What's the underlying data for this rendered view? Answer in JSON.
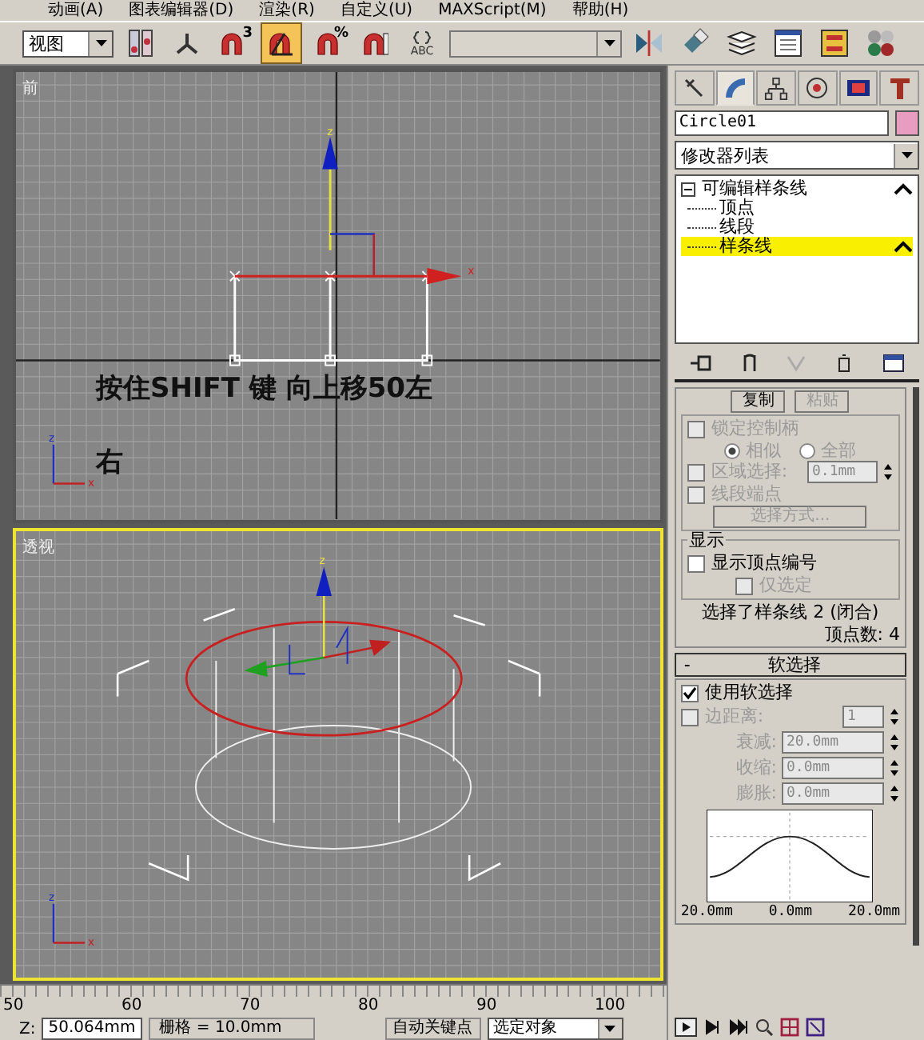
{
  "menu": [
    "动画(A)",
    "图表编辑器(D)",
    "渲染(R)",
    "自定义(U)",
    "MAXScript(M)",
    "帮助(H)"
  ],
  "toolbar": {
    "view_dropdown": "视图",
    "tools": [
      {
        "kind": "pivot",
        "selected": false
      },
      {
        "kind": "axis",
        "selected": false
      },
      {
        "kind": "snap",
        "label": "3",
        "selected": false
      },
      {
        "kind": "angle-snap",
        "selected": true
      },
      {
        "kind": "snap",
        "label": "%",
        "selected": false
      },
      {
        "kind": "spinner-snap",
        "selected": false
      },
      {
        "kind": "named-selection",
        "label": "ABC",
        "selected": false
      },
      {
        "kind": "selection-set",
        "selected": false
      },
      {
        "kind": "mirror",
        "selected": false
      },
      {
        "kind": "align",
        "selected": false
      },
      {
        "kind": "layers",
        "selected": false
      },
      {
        "kind": "curve-editor",
        "selected": false
      },
      {
        "kind": "schematic",
        "selected": false
      },
      {
        "kind": "material",
        "selected": false
      }
    ]
  },
  "viewports": [
    {
      "kind": "front",
      "label": "前",
      "active": false,
      "annotation": "按住SHIFT 键  向上移50左",
      "annotation_2": "右",
      "gizmo_z": "z",
      "gizmo_x": "x",
      "axis_z": "z",
      "axis_x": "x"
    },
    {
      "kind": "perspective",
      "label": "透视",
      "active": true,
      "gizmo_z": "z",
      "axis_z": "z",
      "axis_x": "x"
    }
  ],
  "command_panel": {
    "tabs": [
      {
        "kind": "create",
        "selected": false
      },
      {
        "kind": "modify",
        "selected": true
      },
      {
        "kind": "hierarchy",
        "selected": false
      },
      {
        "kind": "motion",
        "selected": false
      },
      {
        "kind": "display",
        "selected": false
      },
      {
        "kind": "utilities",
        "selected": false
      }
    ],
    "object": {
      "name": "Circle01",
      "color": "#e89cc0"
    },
    "modifier_list": "修改器列表",
    "stack": {
      "label": "可编辑样条线",
      "expanded": true,
      "children": [
        {
          "label": "顶点",
          "selected": false
        },
        {
          "label": "线段",
          "selected": false
        },
        {
          "label": "样条线",
          "selected": true
        }
      ]
    },
    "selection": {
      "copy": "复制",
      "paste": {
        "label": "粘贴",
        "disabled": true
      },
      "lock_handles": {
        "label": "锁定控制柄",
        "checked": false,
        "disabled": true
      },
      "radios": [
        {
          "label": "相似",
          "selected": true
        },
        {
          "label": "全部",
          "selected": false
        }
      ],
      "area_select": {
        "label": "区域选择:",
        "checked": false,
        "value": "0.1mm"
      },
      "segment_end": {
        "label": "线段端点",
        "checked": false
      },
      "select_by": "选择方式...",
      "display_title": "显示",
      "show_vertex_numbers": {
        "label": "显示顶点编号",
        "checked": false
      },
      "selected_only": {
        "label": "仅选定",
        "checked": false,
        "disabled": true
      },
      "status": "选择了样条线 2 (闭合)",
      "vertex_count": "顶点数: 4"
    },
    "soft_selection": {
      "toggle": "-",
      "title": "软选择",
      "use": {
        "label": "使用软选择",
        "checked": true
      },
      "edge_distance": {
        "label": "边距离:",
        "checked": false,
        "value": "1"
      },
      "params": [
        {
          "label": "衰减:",
          "value": "20.0mm"
        },
        {
          "label": "收缩:",
          "value": "0.0mm"
        },
        {
          "label": "膨胀:",
          "value": "0.0mm"
        }
      ],
      "graph_labels": [
        "20.0mm",
        "0.0mm",
        "20.0mm"
      ]
    }
  },
  "timeline": {
    "ticks": [
      "50",
      "60",
      "70",
      "80",
      "90",
      "100"
    ]
  },
  "status_bar": {
    "z_label": "Z:",
    "z_value": "50.064mm",
    "grid": "栅格 = 10.0mm",
    "auto_key": "自动关键点",
    "key_filter": "选定对象"
  }
}
